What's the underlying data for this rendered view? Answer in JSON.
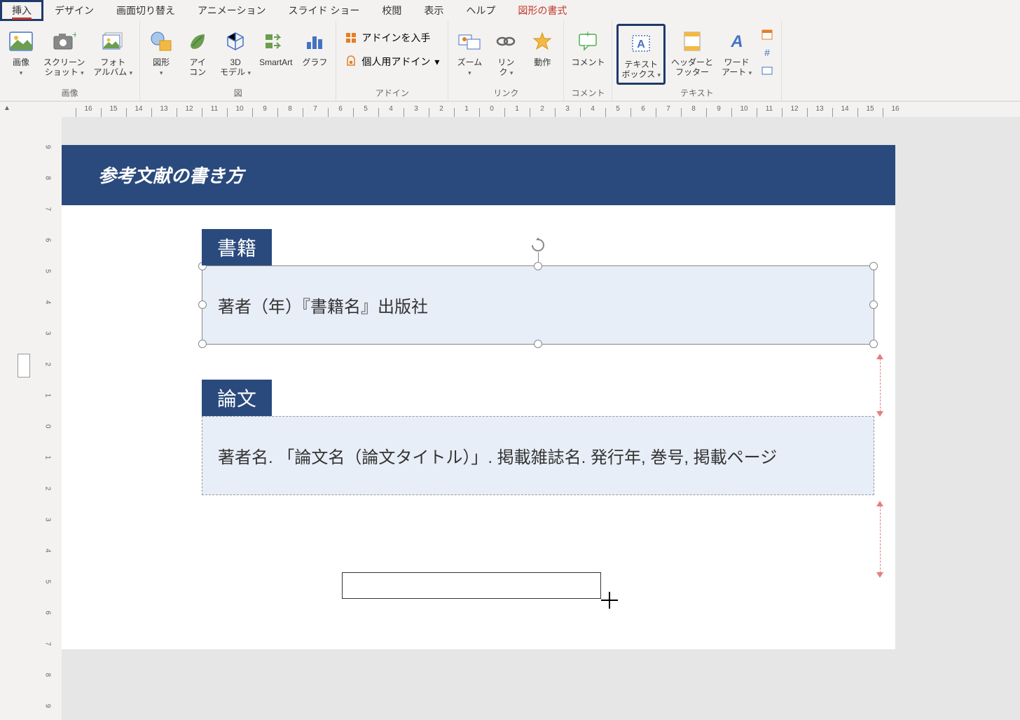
{
  "tabs": {
    "insert": "挿入",
    "design": "デザイン",
    "transitions": "画面切り替え",
    "animations": "アニメーション",
    "slideshow": "スライド ショー",
    "review": "校閲",
    "view": "表示",
    "help": "ヘルプ",
    "shape_format": "図形の書式"
  },
  "ribbon": {
    "groups": {
      "images": "画像",
      "illustrations": "図",
      "addins": "アドイン",
      "links": "リンク",
      "comments": "コメント",
      "text": "テキスト"
    },
    "buttons": {
      "pictures": "画像",
      "screenshot": "スクリーン\nショット",
      "photo_album": "フォト\nアルバム",
      "shapes": "図形",
      "icons": "アイ\nコン",
      "models3d": "3D\nモデル",
      "smartart": "SmartArt",
      "chart": "グラフ",
      "get_addins": "アドインを入手",
      "my_addins": "個人用アドイン",
      "zoom": "ズーム",
      "link": "リン\nク",
      "action": "動作",
      "comment": "コメント",
      "textbox": "テキスト\nボックス",
      "header_footer": "ヘッダーと\nフッター",
      "wordart": "ワード\nアート"
    }
  },
  "slide": {
    "title": "参考文献の書き方",
    "tag1": "書籍",
    "box1": "著者（年）『書籍名』出版社",
    "tag2": "論文",
    "box2": "著者名. 「論文名（論文タイトル）」. 掲載雑誌名. 発行年, 巻号, 掲載ページ"
  },
  "ruler": {
    "h": [
      "16",
      "15",
      "14",
      "13",
      "12",
      "11",
      "10",
      "9",
      "8",
      "7",
      "6",
      "5",
      "4",
      "3",
      "2",
      "1",
      "0",
      "1",
      "2",
      "3",
      "4",
      "5",
      "6",
      "7",
      "8",
      "9",
      "10",
      "11",
      "12",
      "13",
      "14",
      "15",
      "16"
    ],
    "v": [
      "9",
      "8",
      "7",
      "6",
      "5",
      "4",
      "3",
      "2",
      "1",
      "0",
      "1",
      "2",
      "3",
      "4",
      "5",
      "6",
      "7",
      "8",
      "9"
    ]
  }
}
